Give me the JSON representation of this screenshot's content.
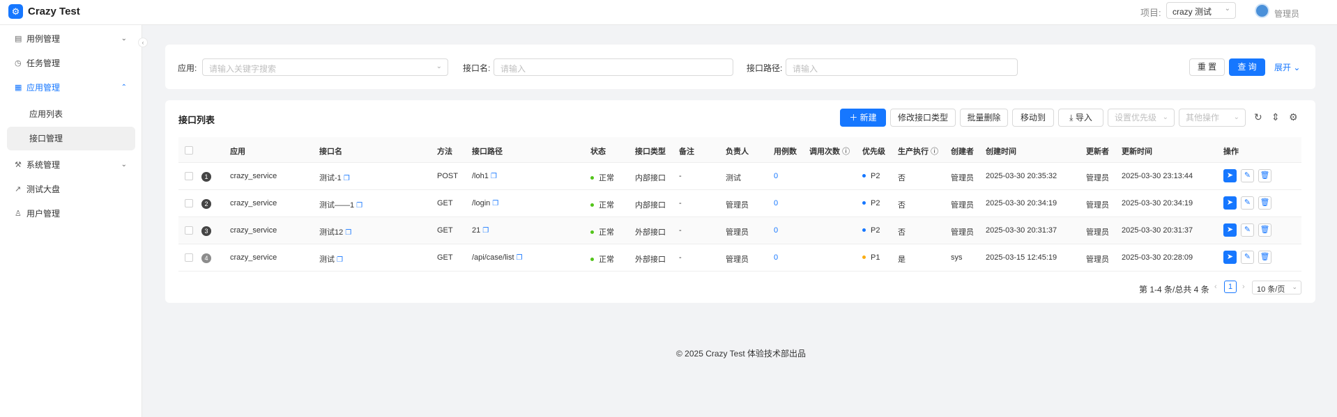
{
  "header": {
    "title": "Crazy Test",
    "project_label": "项目:",
    "project_value": "crazy 测试",
    "user": "管理员"
  },
  "sidebar": {
    "items": [
      {
        "label": "用例管理"
      },
      {
        "label": "任务管理"
      },
      {
        "label": "应用管理"
      },
      {
        "label": "应用列表"
      },
      {
        "label": "接口管理"
      },
      {
        "label": "系统管理"
      },
      {
        "label": "测试大盘"
      },
      {
        "label": "用户管理"
      }
    ]
  },
  "search": {
    "app_label": "应用:",
    "app_placeholder": "请输入关键字搜索",
    "name_label": "接口名:",
    "name_placeholder": "请输入",
    "path_label": "接口路径:",
    "path_placeholder": "请输入",
    "reset": "重 置",
    "query": "查 询",
    "expand": "展开"
  },
  "table_card": {
    "title": "接口列表",
    "new_btn": "新建",
    "modify_type_btn": "修改接口类型",
    "batch_delete_btn": "批量删除",
    "move_btn": "移动到",
    "import_btn": "导入",
    "priority_select": "设置优先级",
    "other_select": "其他操作"
  },
  "columns": [
    "应用",
    "接口名",
    "方法",
    "接口路径",
    "状态",
    "接口类型",
    "备注",
    "负责人",
    "用例数",
    "调用次数",
    "优先级",
    "生产执行",
    "创建者",
    "创建时间",
    "更新者",
    "更新时间",
    "操作"
  ],
  "rows": [
    {
      "idx": "1",
      "app": "crazy_service",
      "name": "测试-1",
      "method": "POST",
      "path": "/loh1",
      "status": "正常",
      "type": "内部接口",
      "remark": "-",
      "owner": "测试",
      "cases": "0",
      "priority": "P2",
      "prod": "否",
      "creator": "管理员",
      "created": "2025-03-30 20:35:32",
      "updater": "管理员",
      "updated": "2025-03-30 23:13:44"
    },
    {
      "idx": "2",
      "app": "crazy_service",
      "name": "测试——1",
      "method": "GET",
      "path": "/login",
      "status": "正常",
      "type": "内部接口",
      "remark": "-",
      "owner": "管理员",
      "cases": "0",
      "priority": "P2",
      "prod": "否",
      "creator": "管理员",
      "created": "2025-03-30 20:34:19",
      "updater": "管理员",
      "updated": "2025-03-30 20:34:19"
    },
    {
      "idx": "3",
      "app": "crazy_service",
      "name": "测试12",
      "method": "GET",
      "path": "21",
      "status": "正常",
      "type": "外部接口",
      "remark": "-",
      "owner": "管理员",
      "cases": "0",
      "priority": "P2",
      "prod": "否",
      "creator": "管理员",
      "created": "2025-03-30 20:31:37",
      "updater": "管理员",
      "updated": "2025-03-30 20:31:37"
    },
    {
      "idx": "4",
      "app": "crazy_service",
      "name": "测试",
      "method": "GET",
      "path": "/api/case/list",
      "status": "正常",
      "type": "外部接口",
      "remark": "-",
      "owner": "管理员",
      "cases": "0",
      "priority": "P1",
      "prod": "是",
      "creator": "sys",
      "created": "2025-03-15 12:45:19",
      "updater": "管理员",
      "updated": "2025-03-30 20:28:09"
    }
  ],
  "pagination": {
    "summary": "第 1-4 条/总共 4 条",
    "current": "1",
    "page_size": "10 条/页"
  },
  "footer": "© 2025 Crazy Test 体验技术部出品",
  "colors": {
    "primary": "#1677ff",
    "status_ok": "#52c41a",
    "p2": "#1677ff",
    "p1": "#faad14"
  }
}
